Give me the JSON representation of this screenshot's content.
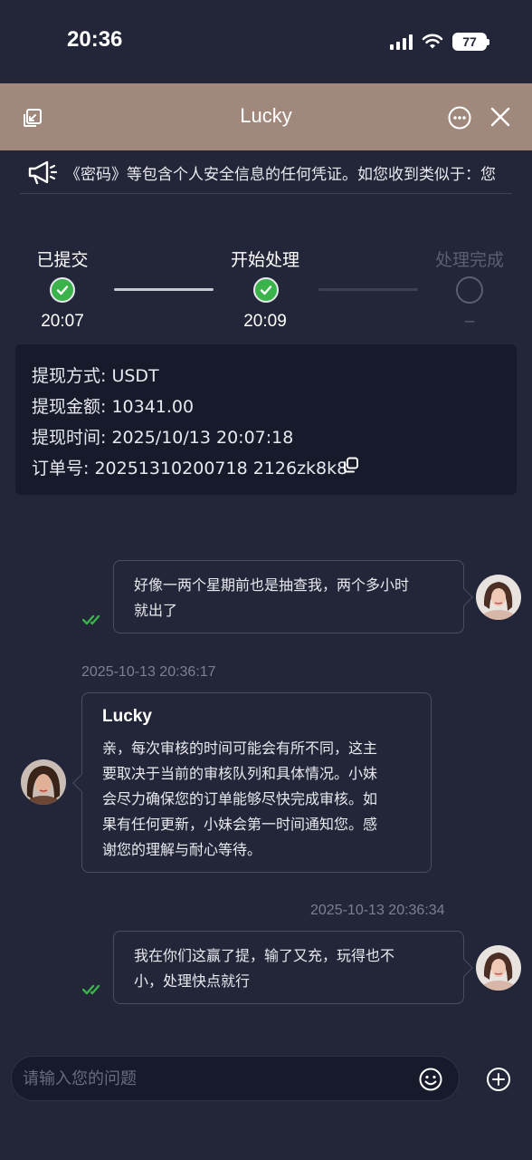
{
  "status_bar": {
    "time": "20:36",
    "battery": "77"
  },
  "header": {
    "title": "Lucky"
  },
  "notice": {
    "text": "《密码》等包含个人安全信息的任何凭证。如您收到类似于：您"
  },
  "progress": {
    "steps": [
      {
        "label": "已提交",
        "time": "20:07",
        "status": "done"
      },
      {
        "label": "开始处理",
        "time": "20:09",
        "status": "done"
      },
      {
        "label": "处理完成",
        "time": "–",
        "status": "pending"
      }
    ]
  },
  "withdrawal": {
    "method": "提现方式: USDT",
    "amount": "提现金额: 10341.00",
    "time": "提现时间: 2025/10/13 20:07:18",
    "order": "订单号: 20251310200718 2126zk8k8"
  },
  "messages": [
    {
      "side": "user",
      "lines": [
        "好像一两个星期前也是抽查我，两个多小时",
        "就出了"
      ]
    },
    {
      "side": "agent",
      "timestamp": "2025-10-13 20:36:17",
      "sender": "Lucky",
      "lines": [
        "亲，每次审核的时间可能会有所不同，这主",
        "要取决于当前的审核队列和具体情况。小妹",
        "会尽力确保您的订单能够尽快完成审核。如",
        "果有任何更新，小妹会第一时间通知您。感",
        "谢您的理解与耐心等待。"
      ]
    },
    {
      "side": "user",
      "timestamp": "2025-10-13 20:36:34",
      "lines": [
        "我在你们这赢了提，输了又充，玩得也不",
        "小，处理快点就行"
      ]
    }
  ],
  "input": {
    "placeholder": "请输入您的问题"
  },
  "colors": {
    "header_bg": "#a0897c",
    "page_bg": "#232638",
    "check_green": "#3ab34a",
    "card_bg": "#171a2b"
  }
}
